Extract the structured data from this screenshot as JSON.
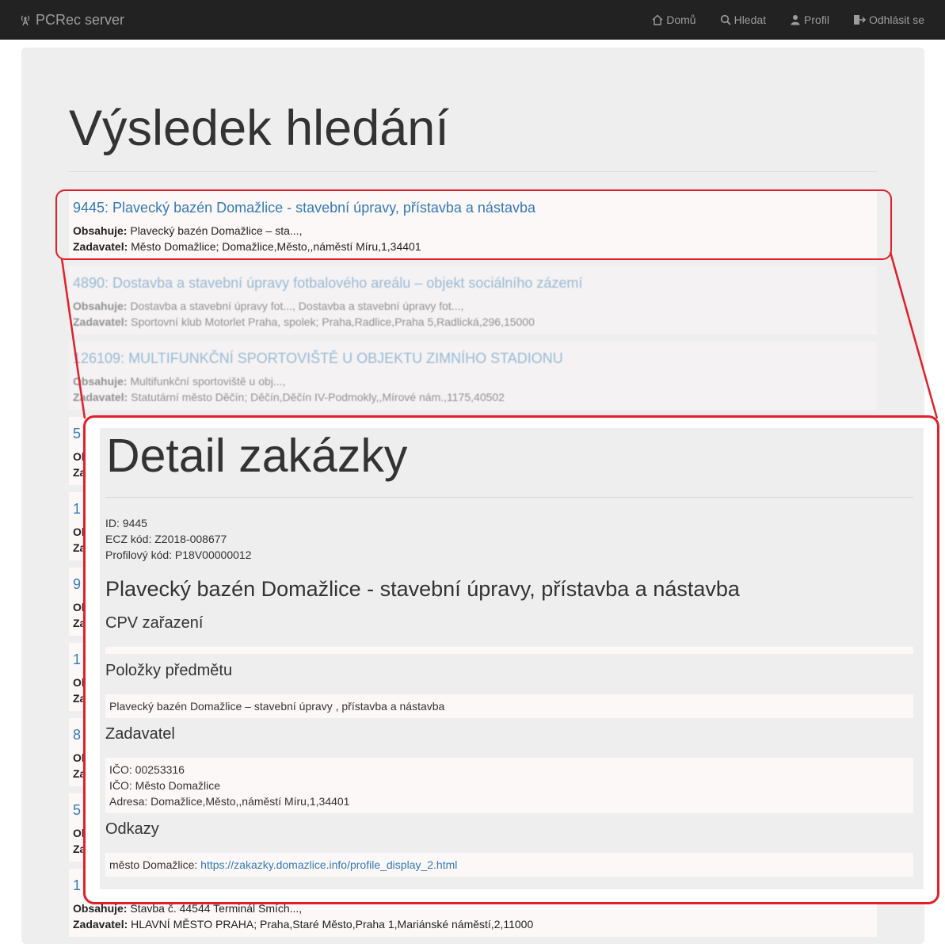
{
  "navbar": {
    "brand": "PCRec server",
    "items": [
      {
        "label": "Domů",
        "icon": "home-icon"
      },
      {
        "label": "Hledat",
        "icon": "search-icon"
      },
      {
        "label": "Profil",
        "icon": "user-icon"
      },
      {
        "label": "Odhlásit se",
        "icon": "logout-icon"
      }
    ]
  },
  "page": {
    "title": "Výsledek hledání"
  },
  "results": {
    "labels": {
      "contains": "Obsahuje:",
      "submitter": "Zadavatel:"
    },
    "items": [
      {
        "title": "9445: Plavecký bazén Domažlice - stavební úpravy, přístavba a nástavba",
        "contains": "Plavecký bazén Domažlice – sta...,",
        "submitter": "Město Domažlice; Domažlice,Město,,náměstí Míru,1,34401"
      },
      {
        "title": "4890: Dostavba a stavební úpravy fotbalového areálu – objekt sociálního zázemí",
        "contains": "Dostavba a stavební úpravy fot..., Dostavba a stavební úpravy fot...,",
        "submitter": "Sportovní klub Motorlet Praha, spolek; Praha,Radlice,Praha 5,Radlická,296,15000"
      },
      {
        "title": "126109: MULTIFUNKČNÍ SPORTOVIŠTĚ U OBJEKTU ZIMNÍHO STADIONU",
        "contains": "Multifunkční sportoviště u obj...,",
        "submitter": "Statutární město Děčín; Děčín,Děčín IV-Podmokly,,Mírové nám.,1175,40502"
      },
      {
        "title": "5",
        "contains": "",
        "submitter": ""
      },
      {
        "title": "1",
        "contains": "",
        "submitter": ""
      },
      {
        "title": "9",
        "contains": "",
        "submitter": ""
      },
      {
        "title": "1",
        "contains": "",
        "submitter": ""
      },
      {
        "title": "8",
        "contains": "",
        "submitter": ""
      },
      {
        "title": "5",
        "contains": "",
        "submitter": ""
      },
      {
        "title": "1",
        "contains": "Stavba č. 44544 Terminál Smích...,",
        "submitter": "HLAVNÍ MĚSTO PRAHA; Praha,Staré Město,Praha 1,Mariánské náměstí,2,11000"
      }
    ]
  },
  "detail": {
    "title": "Detail zakázky",
    "id_line": "ID: 9445",
    "ecz_line": "ECZ kód: Z2018-008677",
    "profile_line": "Profilový kód: P18V00000012",
    "name": "Plavecký bazén Domažlice - stavební úpravy, přístavba a nástavba",
    "cpv_heading": "CPV zařazení",
    "items_heading": "Položky předmětu",
    "item_text": "Plavecký bazén Domažlice – stavební úpravy , přístavba a nástavba",
    "submitter_heading": "Zadavatel",
    "ico_line": "IČO: 00253316",
    "name_line": "IČO: Město Domažlice",
    "address_line": "Adresa: Domažlice,Město,,náměstí Míru,1,34401",
    "links_heading": "Odkazy",
    "link_prefix": "město Domažlice: ",
    "link_text": "https://zakazky.domazlice.info/profile_display_2.html"
  },
  "colors": {
    "highlight": "#e0202a",
    "link": "#337ab7",
    "navbar": "#222222"
  }
}
